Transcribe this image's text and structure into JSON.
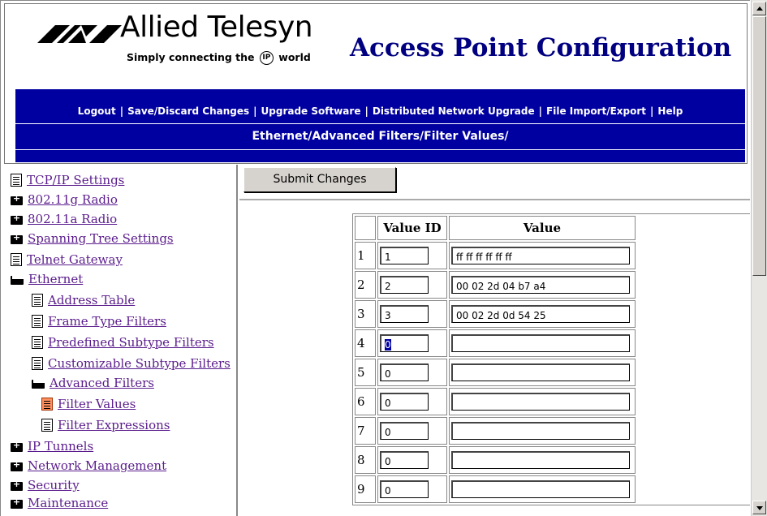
{
  "header": {
    "brand_name": "Allied Telesyn",
    "tagline_pre": "Simply connecting the",
    "tagline_ip": "IP",
    "tagline_post": "world",
    "app_title": "Access Point Configuration",
    "nav_links": [
      "Logout",
      "Save/Discard Changes",
      "Upgrade Software",
      "Distributed Network Upgrade",
      "File Import/Export",
      "Help"
    ],
    "breadcrumb": "Ethernet/Advanced Filters/Filter Values/",
    "bar_color": "#0000a0",
    "title_color": "#000080"
  },
  "sidebar": {
    "items": [
      {
        "label": "TCP/IP Settings",
        "icon": "document-icon"
      },
      {
        "label": "802.11g Radio",
        "icon": "folder-closed-icon"
      },
      {
        "label": "802.11a Radio",
        "icon": "folder-closed-icon"
      },
      {
        "label": "Spanning Tree Settings",
        "icon": "folder-closed-icon"
      },
      {
        "label": "Telnet Gateway",
        "icon": "document-icon"
      },
      {
        "label": "Ethernet",
        "icon": "folder-open-icon"
      },
      {
        "label": "Address Table",
        "icon": "document-icon"
      },
      {
        "label": "Frame Type Filters",
        "icon": "document-icon"
      },
      {
        "label": "Predefined Subtype Filters",
        "icon": "document-icon"
      },
      {
        "label": "Customizable Subtype Filters",
        "icon": "document-icon"
      },
      {
        "label": "Advanced Filters",
        "icon": "folder-open-icon"
      },
      {
        "label": "Filter Values",
        "icon": "document-active-icon"
      },
      {
        "label": "Filter Expressions",
        "icon": "document-icon"
      },
      {
        "label": "IP Tunnels",
        "icon": "folder-closed-icon"
      },
      {
        "label": "Network Management",
        "icon": "folder-closed-icon"
      },
      {
        "label": "Security",
        "icon": "folder-closed-icon"
      },
      {
        "label": "Maintenance",
        "icon": "folder-closed-icon"
      }
    ]
  },
  "main": {
    "submit_label": "Submit Changes",
    "table": {
      "headers": [
        "",
        "Value ID",
        "Value"
      ],
      "rows": [
        {
          "num": "1",
          "value_id": "1",
          "value": "ff ff ff ff ff ff"
        },
        {
          "num": "2",
          "value_id": "2",
          "value": "00 02 2d 04 b7 a4"
        },
        {
          "num": "3",
          "value_id": "3",
          "value": "00 02 2d 0d 54 25"
        },
        {
          "num": "4",
          "value_id": "0",
          "value": ""
        },
        {
          "num": "5",
          "value_id": "0",
          "value": ""
        },
        {
          "num": "6",
          "value_id": "0",
          "value": ""
        },
        {
          "num": "7",
          "value_id": "0",
          "value": ""
        },
        {
          "num": "8",
          "value_id": "0",
          "value": ""
        },
        {
          "num": "9",
          "value_id": "0",
          "value": ""
        }
      ]
    }
  }
}
